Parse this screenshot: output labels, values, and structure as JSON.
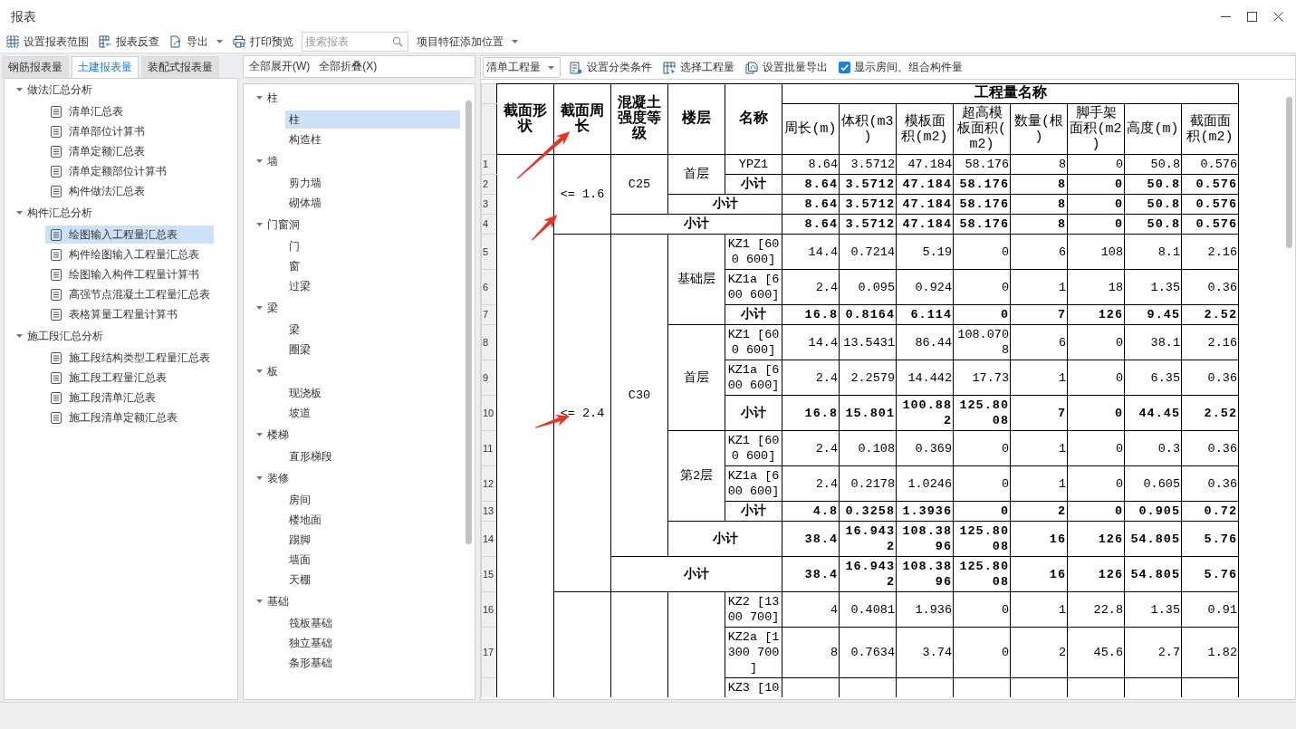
{
  "window": {
    "title": "报表"
  },
  "toolbar": [
    {
      "kind": "button",
      "label": "设置报表范围",
      "dropdown": false
    },
    {
      "kind": "button",
      "label": "报表反查",
      "dropdown": false
    },
    {
      "kind": "button",
      "label": "导出",
      "dropdown": true
    },
    {
      "kind": "button",
      "label": "打印预览",
      "dropdown": false
    },
    {
      "kind": "search",
      "placeholder": "搜索报表"
    },
    {
      "kind": "button",
      "label": "项目特征添加位置",
      "dropdown": true
    }
  ],
  "report_tabs": [
    {
      "label": "钢筋报表量",
      "selected": false
    },
    {
      "label": "土建报表量",
      "selected": true
    },
    {
      "label": "装配式报表量",
      "selected": false
    }
  ],
  "report_tree": [
    {
      "label": "做法汇总分析",
      "expanded": true,
      "children": [
        {
          "label": "清单汇总表",
          "selected": false
        },
        {
          "label": "清单部位计算书",
          "selected": false
        },
        {
          "label": "清单定额汇总表",
          "selected": false
        },
        {
          "label": "清单定额部位计算书",
          "selected": false
        },
        {
          "label": "构件做法汇总表",
          "selected": false
        }
      ]
    },
    {
      "label": "构件汇总分析",
      "expanded": true,
      "children": [
        {
          "label": "绘图输入工程量汇总表",
          "selected": true
        },
        {
          "label": "构件绘图输入工程量汇总表",
          "selected": false
        },
        {
          "label": "绘图输入构件工程量计算书",
          "selected": false
        },
        {
          "label": "高强节点混凝土工程量汇总表",
          "selected": false
        },
        {
          "label": "表格算量工程量计算书",
          "selected": false
        }
      ]
    },
    {
      "label": "施工段汇总分析",
      "expanded": true,
      "children": [
        {
          "label": "施工段结构类型工程量汇总表",
          "selected": false
        },
        {
          "label": "施工段工程量汇总表",
          "selected": false
        },
        {
          "label": "施工段清单汇总表",
          "selected": false
        },
        {
          "label": "施工段清单定额汇总表",
          "selected": false
        }
      ]
    }
  ],
  "category_panel": {
    "actions": [
      "全部展开(W)",
      "全部折叠(X)"
    ],
    "tree": [
      {
        "label": "柱",
        "expanded": true,
        "children": [
          {
            "label": "柱",
            "selected": true
          },
          {
            "label": "构造柱",
            "selected": false
          }
        ]
      },
      {
        "label": "墙",
        "expanded": true,
        "children": [
          {
            "label": "剪力墙",
            "selected": false
          },
          {
            "label": "砌体墙",
            "selected": false
          }
        ]
      },
      {
        "label": "门窗洞",
        "expanded": true,
        "children": [
          {
            "label": "门",
            "selected": false
          },
          {
            "label": "窗",
            "selected": false
          },
          {
            "label": "过梁",
            "selected": false
          }
        ]
      },
      {
        "label": "梁",
        "expanded": true,
        "children": [
          {
            "label": "梁",
            "selected": false
          },
          {
            "label": "圈梁",
            "selected": false
          }
        ]
      },
      {
        "label": "板",
        "expanded": true,
        "children": [
          {
            "label": "现浇板",
            "selected": false
          },
          {
            "label": "坡道",
            "selected": false
          }
        ]
      },
      {
        "label": "楼梯",
        "expanded": true,
        "children": [
          {
            "label": "直形梯段",
            "selected": false
          }
        ]
      },
      {
        "label": "装修",
        "expanded": true,
        "children": [
          {
            "label": "房间",
            "selected": false
          },
          {
            "label": "楼地面",
            "selected": false
          },
          {
            "label": "踢脚",
            "selected": false
          },
          {
            "label": "墙面",
            "selected": false
          },
          {
            "label": "天棚",
            "selected": false
          }
        ]
      },
      {
        "label": "基础",
        "expanded": true,
        "children": [
          {
            "label": "筏板基础",
            "selected": false
          },
          {
            "label": "独立基础",
            "selected": false
          },
          {
            "label": "条形基础",
            "selected": false
          }
        ]
      }
    ]
  },
  "quantity_toolbar": {
    "mode": "清单工程量",
    "buttons": [
      "设置分类条件",
      "选择工程量",
      "设置批量导出"
    ],
    "option": {
      "label": "显示房间、组合构件量",
      "checked": true
    }
  },
  "table": {
    "fixed_columns": [
      "截面形状",
      "截面周长",
      "混凝土强度等级",
      "楼层",
      "名称"
    ],
    "group_header": "工程量名称",
    "quantity_columns": [
      "周长(m)",
      "体积(m3)",
      "模板面积(m2)",
      "超高模板面积(m2)",
      "数量(根)",
      "脚手架面积(m2)",
      "高度(m)",
      "截面面积(m2)"
    ],
    "rows": [
      {
        "number": "1",
        "kind": "item",
        "labels": [
          {
            "rowspan": 18
          },
          {
            "text": "<= 1.6",
            "rowspan": 4
          },
          {
            "text": "C25",
            "rowspan": 3
          },
          {
            "text": "首层",
            "rowspan": 2
          },
          {
            "text": "YPZ1"
          }
        ],
        "values": [
          "8.64",
          "3.5712",
          "47.184",
          "58.176",
          "8",
          "0",
          "50.8",
          "0.576"
        ]
      },
      {
        "number": "2",
        "kind": "subtotal",
        "labels": [
          {
            "text": "小计"
          }
        ],
        "values": [
          "8.64",
          "3.5712",
          "47.184",
          "58.176",
          "8",
          "0",
          "50.8",
          "0.576"
        ]
      },
      {
        "number": "3",
        "kind": "subtotal",
        "labels": [
          {
            "text": "小计",
            "colspan": 2
          }
        ],
        "values": [
          "8.64",
          "3.5712",
          "47.184",
          "58.176",
          "8",
          "0",
          "50.8",
          "0.576"
        ]
      },
      {
        "number": "4",
        "kind": "subtotal",
        "labels": [
          {
            "text": "小计",
            "colspan": 3
          }
        ],
        "values": [
          "8.64",
          "3.5712",
          "47.184",
          "58.176",
          "8",
          "0",
          "50.8",
          "0.576"
        ]
      },
      {
        "number": "5",
        "kind": "item",
        "labels": [
          {
            "text": "<= 2.4",
            "rowspan": 11
          },
          {
            "text": "C30",
            "rowspan": 10
          },
          {
            "text": "基础层",
            "rowspan": 3
          },
          {
            "text": "KZ1 [600 600]"
          }
        ],
        "values": [
          "14.4",
          "0.7214",
          "5.19",
          "0",
          "6",
          "108",
          "8.1",
          "2.16"
        ]
      },
      {
        "number": "6",
        "kind": "item",
        "labels": [
          {
            "text": "KZ1a [600 600]"
          }
        ],
        "values": [
          "2.4",
          "0.095",
          "0.924",
          "0",
          "1",
          "18",
          "1.35",
          "0.36"
        ]
      },
      {
        "number": "7",
        "kind": "subtotal",
        "labels": [
          {
            "text": "小计"
          }
        ],
        "values": [
          "16.8",
          "0.8164",
          "6.114",
          "0",
          "7",
          "126",
          "9.45",
          "2.52"
        ]
      },
      {
        "number": "8",
        "kind": "item",
        "labels": [
          {
            "text": "首层",
            "rowspan": 3
          },
          {
            "text": "KZ1 [600 600]"
          }
        ],
        "values": [
          "14.4",
          "13.5431",
          "86.44",
          "108.0708",
          "6",
          "0",
          "38.1",
          "2.16"
        ]
      },
      {
        "number": "9",
        "kind": "item",
        "labels": [
          {
            "text": "KZ1a [600 600]"
          }
        ],
        "values": [
          "2.4",
          "2.2579",
          "14.442",
          "17.73",
          "1",
          "0",
          "6.35",
          "0.36"
        ]
      },
      {
        "number": "10",
        "kind": "subtotal",
        "labels": [
          {
            "text": "小计"
          }
        ],
        "values": [
          "16.8",
          "15.801",
          "100.882",
          "125.8008",
          "7",
          "0",
          "44.45",
          "2.52"
        ]
      },
      {
        "number": "11",
        "kind": "item",
        "labels": [
          {
            "text": "第2层",
            "rowspan": 3
          },
          {
            "text": "KZ1 [600 600]"
          }
        ],
        "values": [
          "2.4",
          "0.108",
          "0.369",
          "0",
          "1",
          "0",
          "0.3",
          "0.36"
        ]
      },
      {
        "number": "12",
        "kind": "item",
        "labels": [
          {
            "text": "KZ1a [600 600]"
          }
        ],
        "values": [
          "2.4",
          "0.2178",
          "1.0246",
          "0",
          "1",
          "0",
          "0.605",
          "0.36"
        ]
      },
      {
        "number": "13",
        "kind": "subtotal",
        "labels": [
          {
            "text": "小计"
          }
        ],
        "values": [
          "4.8",
          "0.3258",
          "1.3936",
          "0",
          "2",
          "0",
          "0.905",
          "0.72"
        ]
      },
      {
        "number": "14",
        "kind": "subtotal",
        "labels": [
          {
            "text": "小计",
            "colspan": 2
          }
        ],
        "values": [
          "38.4",
          "16.9432",
          "108.3896",
          "125.8008",
          "16",
          "126",
          "54.805",
          "5.76"
        ]
      },
      {
        "number": "15",
        "kind": "subtotal",
        "labels": [
          {
            "text": "小计",
            "colspan": 3
          }
        ],
        "values": [
          "38.4",
          "16.9432",
          "108.3896",
          "125.8008",
          "16",
          "126",
          "54.805",
          "5.76"
        ]
      },
      {
        "number": "16",
        "kind": "item",
        "labels": [
          {
            "rowspan": 3
          },
          {
            "rowspan": 3
          },
          {
            "rowspan": 3
          },
          {
            "text": "KZ2 [1300 700]"
          }
        ],
        "values": [
          "4",
          "0.4081",
          "1.936",
          "0",
          "1",
          "22.8",
          "1.35",
          "0.91"
        ]
      },
      {
        "number": "17",
        "kind": "item",
        "labels": [
          {
            "text": "KZ2a [1300 700]"
          }
        ],
        "values": [
          "8",
          "0.7634",
          "3.74",
          "0",
          "2",
          "45.6",
          "2.7",
          "1.82"
        ]
      },
      {
        "kind": "item",
        "labels": [
          {
            "text": "KZ3 [10"
          }
        ]
      }
    ]
  }
}
